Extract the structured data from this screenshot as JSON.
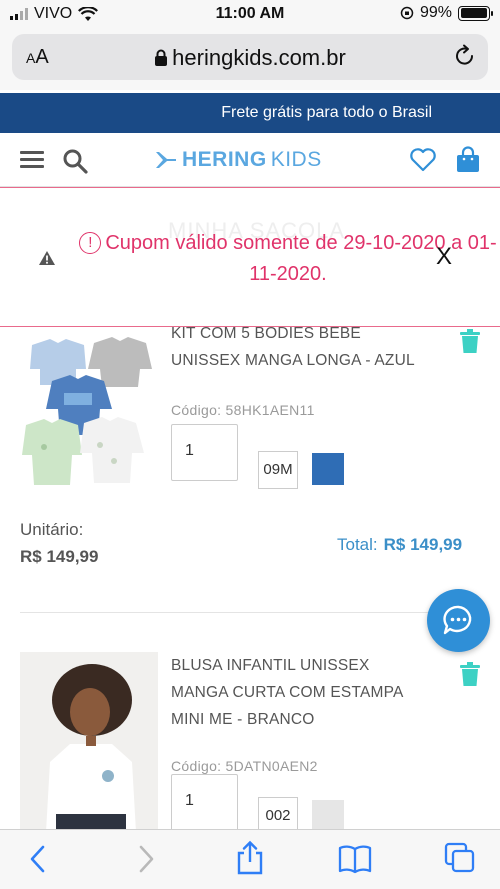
{
  "status": {
    "carrier": "VIVO",
    "time": "11:00 AM",
    "battery": "99%",
    "battery_level": 0.99
  },
  "browser": {
    "aa": "AA",
    "host": "heringkids.com.br"
  },
  "promo": "Frete grátis para todo o Brasil",
  "brand": {
    "logo_bold": "HERING",
    "logo_light": "KIDS"
  },
  "toast": {
    "ghost": "MINHA SACOLA",
    "message": "Cupom válido somente de 29-10-2020 a 01-11-2020.",
    "close": "X"
  },
  "products": [
    {
      "title_line1": "KIT COM 5 BODIES BEBÊ",
      "title_line2": "UNISSEX MANGA LONGA - AZUL",
      "code": "Código: 58HK1AEN11",
      "qty": "1",
      "size": "09M",
      "color": "#2f6db5",
      "unit_label": "Unitário:",
      "unit_price": "R$ 149,99",
      "total_label": "Total:",
      "total_price": "R$ 149,99"
    },
    {
      "title_line1": "BLUSA INFANTIL UNISSEX",
      "title_line2": "MANGA CURTA COM ESTAMPA",
      "title_line3": "MINI ME - BRANCO",
      "code": "Código: 5DATN0AEN2",
      "qty": "1",
      "size": "002",
      "color": "#e6e6e6"
    }
  ],
  "colors": {
    "brand_blue": "#1a4a86",
    "accent_blue": "#3b8fc8",
    "teal": "#3dd1c4",
    "toast_pink": "#e0336a"
  }
}
